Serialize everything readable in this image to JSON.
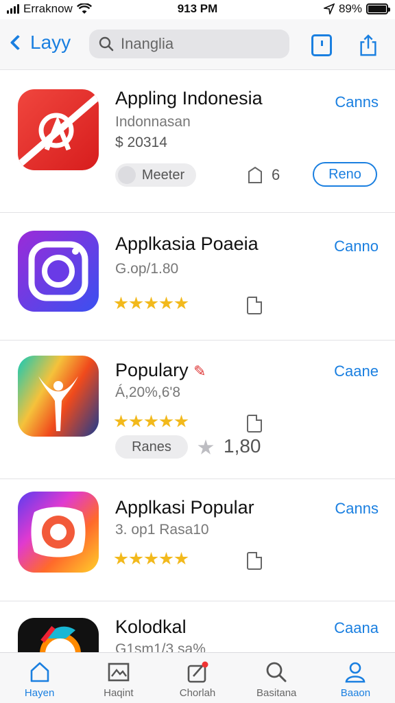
{
  "status_bar": {
    "carrier": "Erraknow",
    "time": "913 PM",
    "battery": "89%"
  },
  "nav": {
    "back_label": "Layy",
    "search_value": "Inanglia"
  },
  "apps": [
    {
      "name": "Appling Indonesia",
      "subtitle": "Indonnasan",
      "meta": "$ 20314",
      "get_label": "Canns",
      "pill_label": "Meeter",
      "count": "6",
      "button_label": "Reno",
      "icon_colors": [
        "#e52e2a",
        "#ffffff"
      ]
    },
    {
      "name": "Applkasia Poaeia",
      "subtitle": "G.op/1.80",
      "get_label": "Canno",
      "rating": 5,
      "icon_colors": [
        "#8a2be2",
        "#3b5bfa"
      ]
    },
    {
      "name": "Populary",
      "subtitle": "Á,20%,6'8",
      "get_label": "Caane",
      "rating": 5,
      "pill_label": "Ranes",
      "rating_count": "1,80",
      "icon_colors": [
        "#1ec7b5",
        "#f2511b"
      ]
    },
    {
      "name": "Applkasi Popular",
      "subtitle": "3. op1 Rasa10",
      "get_label": "Canns",
      "rating": 5,
      "icon_colors": [
        "#6a3df0",
        "#ff9a1f"
      ]
    },
    {
      "name": "Kolodkal",
      "subtitle": "G1sm1/3 sa%",
      "get_label": "Caana",
      "icon_colors": [
        "#111111",
        "#ff7a00"
      ]
    }
  ],
  "tabs": [
    {
      "label": "Hayen",
      "icon": "home-icon",
      "active": true
    },
    {
      "label": "Haqint",
      "icon": "image-icon",
      "active": false
    },
    {
      "label": "Chorlah",
      "icon": "edit-icon",
      "active": false
    },
    {
      "label": "Basitana",
      "icon": "search-icon",
      "active": false
    },
    {
      "label": "Baaon",
      "icon": "person-icon",
      "active": true
    }
  ],
  "accent_color": "#1a7fe0",
  "star_color": "#f2b91c"
}
